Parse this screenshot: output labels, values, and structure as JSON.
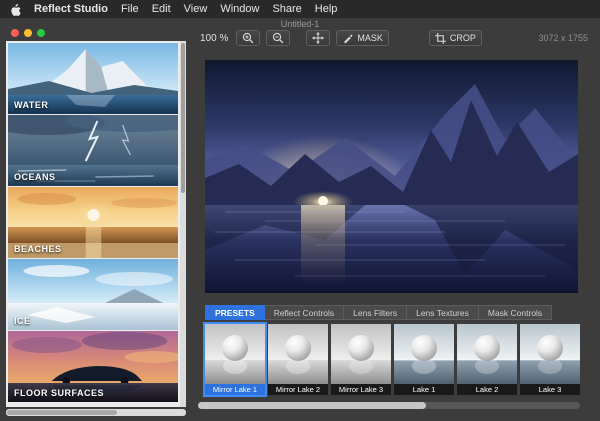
{
  "menubar": {
    "app_name": "Reflect Studio",
    "items": [
      {
        "label": "File"
      },
      {
        "label": "Edit"
      },
      {
        "label": "View"
      },
      {
        "label": "Window"
      },
      {
        "label": "Share"
      },
      {
        "label": "Help"
      }
    ]
  },
  "window": {
    "title": "Untitled-1"
  },
  "toolbar": {
    "zoom_level": "100 %",
    "mask_label": "MASK",
    "crop_label": "CROP",
    "image_dimensions": "3072 x 1755"
  },
  "sidebar": {
    "categories": [
      {
        "label": "WATER"
      },
      {
        "label": "OCEANS"
      },
      {
        "label": "BEACHES"
      },
      {
        "label": "ICE"
      },
      {
        "label": "FLOOR SURFACES"
      }
    ]
  },
  "tabs": [
    {
      "label": "PRESETS",
      "active": true
    },
    {
      "label": "Reflect Controls",
      "active": false
    },
    {
      "label": "Lens Filters",
      "active": false
    },
    {
      "label": "Lens Textures",
      "active": false
    },
    {
      "label": "Mask Controls",
      "active": false
    }
  ],
  "presets": [
    {
      "label": "Mirror Lake 1",
      "selected": true
    },
    {
      "label": "Mirror Lake 2",
      "selected": false
    },
    {
      "label": "Mirror Lake 3",
      "selected": false
    },
    {
      "label": "Lake 1",
      "selected": false
    },
    {
      "label": "Lake 2",
      "selected": false
    },
    {
      "label": "Lake 3",
      "selected": false
    }
  ],
  "colors": {
    "accent_blue": "#2d72dd",
    "selection_blue": "#3f8cf3",
    "traffic_close": "#ff5f57",
    "traffic_minimize": "#febc2e",
    "traffic_zoom": "#28c840"
  }
}
